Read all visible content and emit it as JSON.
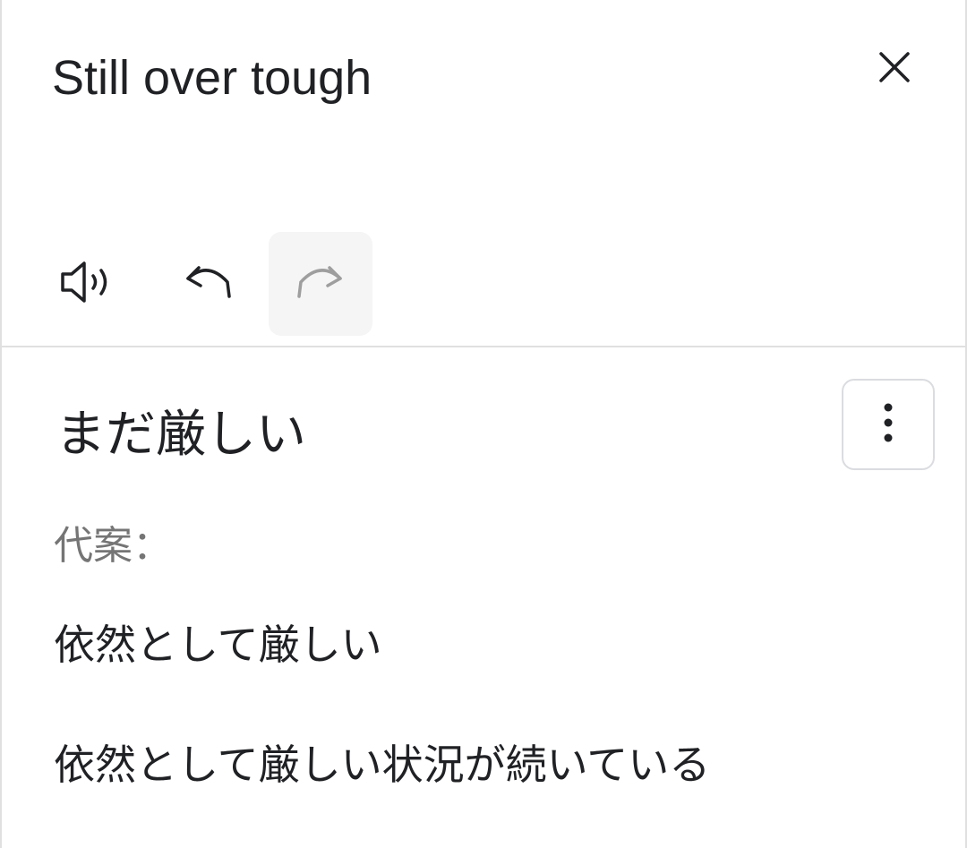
{
  "source": {
    "text": "Still over tough"
  },
  "icons": {
    "close": "close-icon",
    "speaker": "volume-icon",
    "undo": "undo-icon",
    "redo": "redo-icon",
    "more": "more-vert-icon"
  },
  "translation": {
    "text": "まだ厳しい"
  },
  "alternatives": {
    "label": "代案：",
    "items": [
      "依然として厳しい",
      "依然として厳しい状況が続いている"
    ]
  },
  "colors": {
    "text": "#202124",
    "secondary_text": "#757575",
    "divider": "#e0e0e0",
    "disabled_icon": "#9e9e9e",
    "disabled_button_bg": "#f5f5f5"
  }
}
